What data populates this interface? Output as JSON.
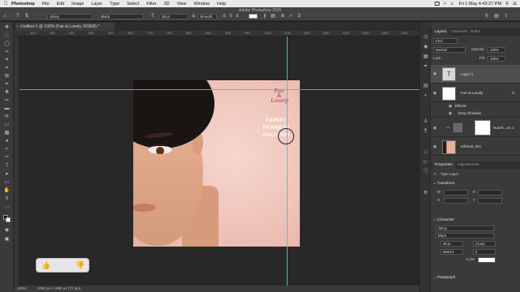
{
  "menubar": {
    "items": [
      "Photoshop",
      "File",
      "Edit",
      "Image",
      "Layer",
      "Type",
      "Select",
      "Filter",
      "3D",
      "View",
      "Window",
      "Help"
    ],
    "datetime": "Fri 1 May 4:43:27 PM"
  },
  "options": {
    "window_title": "Adobe Photoshop 2020",
    "font_family": "Gilroy",
    "font_style": "Black",
    "font_size": "38 pt",
    "antialias": "Smooth",
    "text_color": "#ffffff"
  },
  "document": {
    "tab_title": "Untitled-1 @ 100% (Fair-&-Lovely, RGB/8) *",
    "zoom": "100%",
    "doc_size": "1080 px x 1080 px (72 ppi)",
    "ruler_marks": [
      "400",
      "450",
      "500",
      "550",
      "600",
      "650",
      "700",
      "750",
      "800",
      "850",
      "900",
      "950",
      "1000",
      "1050",
      "1100",
      "1150",
      "1200",
      "1250",
      "1300",
      "1350",
      "1400"
    ]
  },
  "artwork": {
    "logo_line1": "Fair",
    "logo_line2": "&",
    "logo_line3": "Lovely",
    "tag_line1": "EXPERT",
    "tag_line2": "FAIRNESS",
    "tag_line3": "SOLUTION"
  },
  "panels": {
    "tabs": [
      "Layers",
      "Channels",
      "Paths"
    ],
    "kind_filter": "Kind",
    "blend_mode": "Normal",
    "opacity_label": "Opacity:",
    "opacity_value": "100%",
    "lock_label": "Lock:",
    "fill_label": "Fill:",
    "fill_value": "100%",
    "layers": [
      {
        "name": "Layer 1",
        "type": "text"
      },
      {
        "name": "Fair-&-Lovely",
        "type": "smart"
      },
      {
        "name": "Effects",
        "type": "effects"
      },
      {
        "name": "Drop Shadow",
        "type": "effect"
      },
      {
        "name": "Hue/S...on 1",
        "type": "adjustment"
      },
      {
        "name": "ethenol_sko",
        "type": "image"
      }
    ],
    "prop_tabs": [
      "Properties",
      "Adjustments"
    ],
    "prop_kind": "Type Layer",
    "transform_label": "Transform",
    "w_label": "W",
    "h_label": "H",
    "x_label": "X",
    "y_label": "Y",
    "character_label": "Character",
    "char_font": "Gilroy",
    "char_style": "Black",
    "char_size": "38 pt",
    "char_leading": "(Auto)",
    "char_kerning": "Metrics",
    "char_tracking": "0",
    "color_label": "Color",
    "paragraph_label": "Paragraph"
  }
}
